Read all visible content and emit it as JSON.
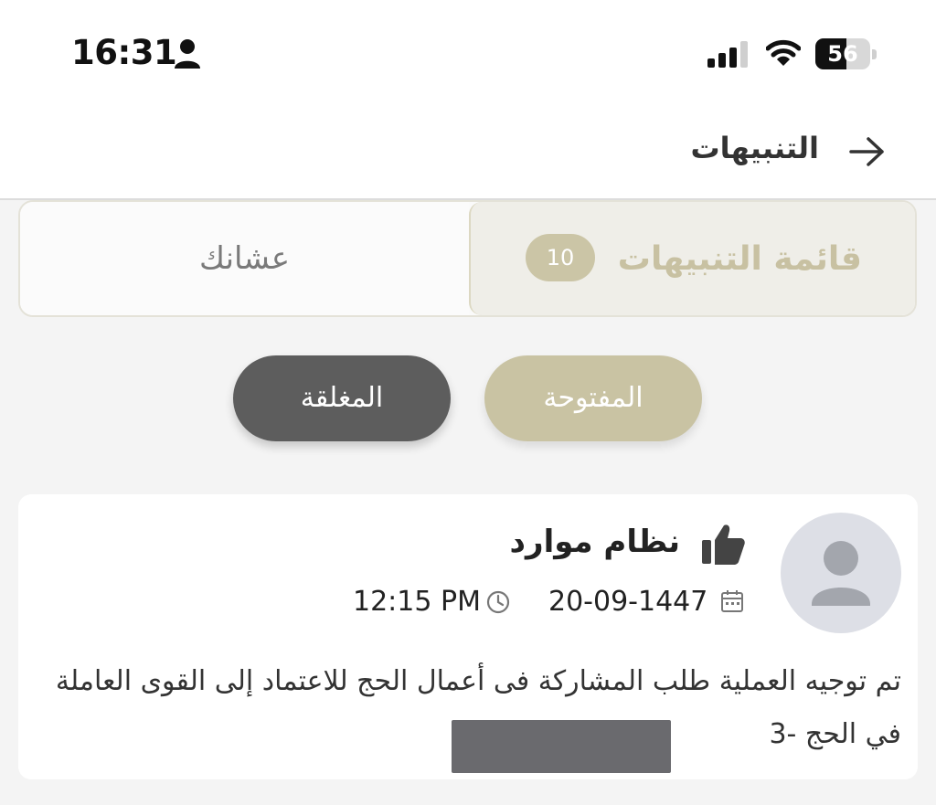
{
  "status_bar": {
    "time": "16:31",
    "battery": "56",
    "battery_fraction": 0.56,
    "icons": [
      "person-icon",
      "signal-icon",
      "wifi-icon",
      "battery-icon"
    ]
  },
  "header": {
    "title": "التنبيهات",
    "back_icon": "arrow-right-icon"
  },
  "tabs": {
    "notifications_label": "قائمة التنبيهات",
    "notifications_count": "10",
    "other_label": "عشانك"
  },
  "filters": {
    "open_label": "المفتوحة",
    "closed_label": "المغلقة"
  },
  "notification": {
    "sender": "نظام موارد",
    "date": "20-09-1447",
    "time": "12:15 PM",
    "message": "تم توجيه العملية طلب المشاركة فى أعمال الحج للاعتماد إلى القوى العاملة في الحج -3",
    "icons": [
      "avatar-icon",
      "thumbs-up-icon",
      "calendar-icon",
      "clock-icon"
    ]
  },
  "colors": {
    "accent": "#c9c3a3",
    "dark_pill": "#5d5d5d",
    "background": "#f4f4f4"
  }
}
